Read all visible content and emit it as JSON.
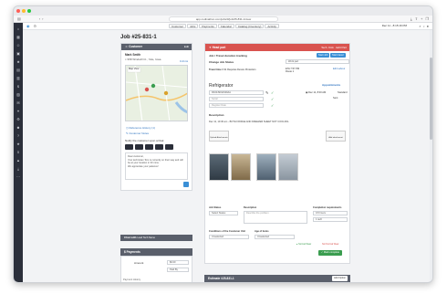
{
  "browser": {
    "url": "app.codinathon.com/jobs/#/job/25-831-1/view",
    "icons": [
      "back-arrow-icon",
      "forward-arrow-icon",
      "reload-icon"
    ]
  },
  "appbar": {
    "tabs": [
      "Customer",
      "Jobs",
      "Payments",
      "Calendar",
      "Catalog (Inventory)",
      "Activity"
    ],
    "datetime": "Dec 11 - 8:15:16 PM",
    "colors": {
      "sidebar": "#2b2f3a",
      "header_accent": "#d9534f",
      "panel_header": "#5a5f6b",
      "link": "#2f74c0",
      "button_blue": "#3a8fd6",
      "ok_green": "#3a9d4f"
    }
  },
  "sidebar": {
    "icons": [
      "home-icon",
      "jobs-icon",
      "customers-icon",
      "calendar-icon",
      "team-icon",
      "inventory-icon",
      "invoice-icon",
      "payments-icon",
      "reports-icon",
      "chat-icon",
      "map-icon",
      "settings-icon",
      "user-icon",
      "help-icon",
      "star-icon",
      "info-icon",
      "stats-icon",
      "download-icon",
      "more-icon"
    ]
  },
  "job": {
    "title": "Job #25-831-1"
  },
  "customer": {
    "header": "Customer",
    "edit": "Edit",
    "name": "Mark Smith",
    "address": "958 Windwill Ct., Yale, Iowa",
    "distance": "0.21mi",
    "map_label": "Map View",
    "links": [
      "Reference History (1)",
      "Customer Notes"
    ],
    "notify_label": "Notify the customer upon arrival",
    "message": "Dear customer,\nYour technician Tom is currently on their way and will be at your location in 30 mins.\nWe appreciate your patience!"
  },
  "chat": {
    "header": "Chat with",
    "sub": "Lead Tech Name"
  },
  "payments": {
    "header": "Payments",
    "amount_label": "Amount",
    "amount_value": "$0.00",
    "method": "Paid By",
    "history": "Payment History"
  },
  "headpart": {
    "header": "Head part",
    "header_right": "Tech. Kick",
    "header_right2": "Edit Part",
    "job_title_line": "Job / Travel duration tracking",
    "btn_start": "Start Job",
    "btn_travel": "Start travel",
    "change_status": "Change Job Status",
    "status_value": "Work part",
    "travel_label": "Travel time",
    "travel_value": "0:31 Requires Device Protection",
    "tech_label": "ETA 7:57 PM",
    "tech_value": "Route 1",
    "call_label": "Edit Labour"
  },
  "appliance": {
    "title": "Refrigerator",
    "appointments_label": "Appointments",
    "model": "RF23J9011SR/AA",
    "serial": "Serial",
    "register_date": "Register Date",
    "appt_date": "Dec 11, 8:00 AM",
    "appt_name": "Standard",
    "assigned": "Sent",
    "description_label": "Description",
    "desc_line": "Dec 11, 10:30 am - BOTH FRIDGE AND FREEZER SHEET NOT COOLING",
    "photos_label": "Upload Attachments",
    "add_photo": "Add attachment",
    "job_status_label": "Job Status",
    "job_status_value": "Select Status",
    "description2_label": "Description",
    "description2_placeholder": "Describe the problem",
    "completion_label": "Completion requirements",
    "completion_1": "0-5 hours",
    "completion_2": "1 tech",
    "conditions_label": "Conditions of the Customer Unit",
    "conditions_value": "Unselected",
    "age_label": "Age of items",
    "age_value": "Unselected",
    "normal_label": "Normal Wear",
    "not_normal_label": "Not Normal Wear",
    "mark_complete": "Mark complete"
  },
  "estimate": {
    "header": "Estimate #25-831-1",
    "add": "Add Option"
  }
}
